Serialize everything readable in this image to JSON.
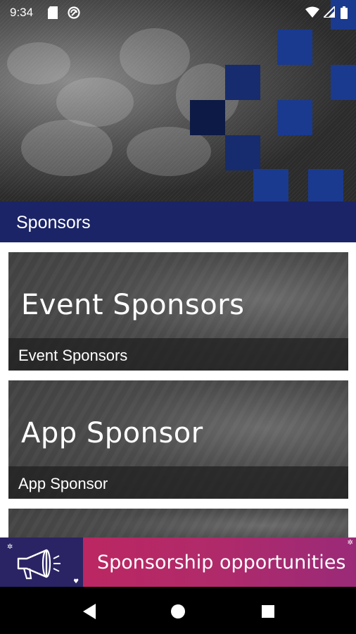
{
  "status_bar": {
    "time": "9:34",
    "icons": [
      "sd-card-icon",
      "sync-icon",
      "wifi-icon",
      "signal-icon",
      "battery-icon"
    ]
  },
  "header": {
    "title": "Sponsors",
    "bar_color": "#1b2466",
    "accent_color": "#1a3a8f"
  },
  "cards": [
    {
      "overlay_title": "Event Sponsors",
      "label": "Event Sponsors"
    },
    {
      "overlay_title": "App Sponsor",
      "label": "App Sponsor"
    }
  ],
  "banner": {
    "text": "Sponsorship opportunities",
    "icon": "megaphone-icon",
    "colors": [
      "#2a2464",
      "#c2255c"
    ]
  },
  "nav": {
    "buttons": [
      "back-icon",
      "home-icon",
      "recents-icon"
    ]
  }
}
